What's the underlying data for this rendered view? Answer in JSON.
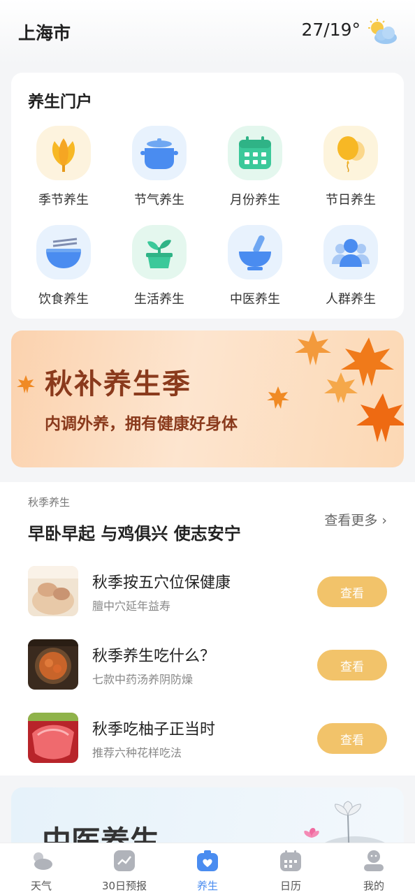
{
  "header": {
    "city": "上海市",
    "temperature": "27/19°"
  },
  "portal": {
    "title": "养生门户",
    "items": [
      {
        "label": "季节养生",
        "icon": "lotus-icon"
      },
      {
        "label": "节气养生",
        "icon": "pot-icon"
      },
      {
        "label": "月份养生",
        "icon": "calendar-icon"
      },
      {
        "label": "节日养生",
        "icon": "balloon-icon"
      },
      {
        "label": "饮食养生",
        "icon": "bowl-icon"
      },
      {
        "label": "生活养生",
        "icon": "plant-icon"
      },
      {
        "label": "中医养生",
        "icon": "mortar-icon"
      },
      {
        "label": "人群养生",
        "icon": "people-icon"
      }
    ]
  },
  "banner": {
    "title": "秋补养生季",
    "subtitle": "内调外养，拥有健康好身体"
  },
  "section": {
    "small_label": "秋季养生",
    "title": "早卧早起 与鸡俱兴 使志安宁",
    "more_label": "查看更多",
    "articles": [
      {
        "title": "秋季按五穴位保健康",
        "subtitle": "膻中穴延年益寿",
        "button": "查看"
      },
      {
        "title": "秋季养生吃什么？",
        "subtitle": "七款中药汤养阴防燥",
        "button": "查看"
      },
      {
        "title": "秋季吃柚子正当时",
        "subtitle": "推荐六种花样吃法",
        "button": "查看"
      }
    ]
  },
  "tcm_card": {
    "title": "中医养生"
  },
  "tabbar": {
    "active_index": 2,
    "tabs": [
      {
        "label": "天气",
        "icon": "weather-icon"
      },
      {
        "label": "30日预报",
        "icon": "trend-icon"
      },
      {
        "label": "养生",
        "icon": "health-icon"
      },
      {
        "label": "日历",
        "icon": "calendar-icon"
      },
      {
        "label": "我的",
        "icon": "profile-icon"
      }
    ]
  },
  "colors": {
    "accent": "#4a8cf0",
    "button": "#f2c36a",
    "banner_text": "#8a3a1c"
  }
}
